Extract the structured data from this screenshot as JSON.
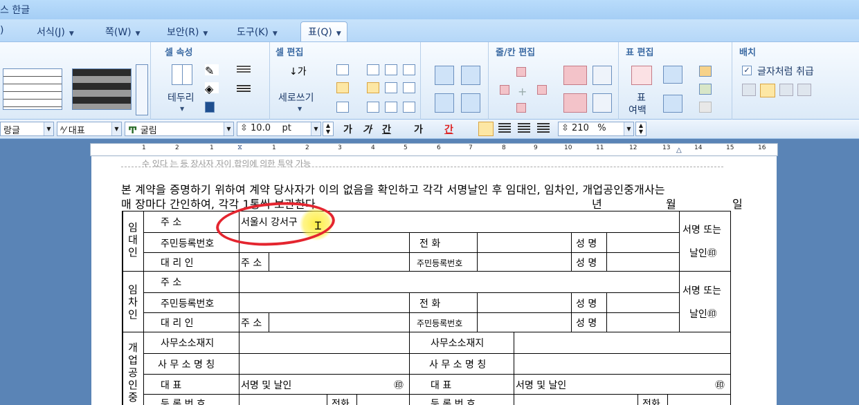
{
  "app": {
    "title_fragment": "스 한글"
  },
  "menu": [
    {
      "label": "서식(J)"
    },
    {
      "label": "쪽(W)"
    },
    {
      "label": "보안(R)"
    },
    {
      "label": "도구(K)"
    },
    {
      "label": "표(Q)"
    }
  ],
  "ribbon": {
    "groups": {
      "cell_attr": "셀 속성",
      "cell_edit": "셀 편집",
      "row_col_edit": "줄/칸 편집",
      "table_edit": "표 편집",
      "arrange": "배치"
    },
    "labels": {
      "border": "테두리",
      "vertical_write": "세로쓰기",
      "table_margin_top": "표",
      "table_margin_bottom": "여백",
      "treat_as_char": "글자처럼 취급"
    },
    "treat_as_char_checked": true
  },
  "format_bar": {
    "style_value": "랑글",
    "font_type": "대표",
    "font_name": "굴림",
    "font_size": "10.0",
    "size_unit": "pt",
    "zoom": "210",
    "zoom_unit": "%",
    "bold_glyph": "가",
    "italic_glyph": "가",
    "underline_glyph": "간",
    "strike_glyph": "가",
    "color_glyph": "간"
  },
  "ruler": {
    "marks": [
      "1",
      "2",
      "1",
      "1",
      "2",
      "3",
      "4",
      "5",
      "6",
      "7",
      "8",
      "9",
      "10",
      "11",
      "12",
      "13",
      "14",
      "15",
      "16"
    ]
  },
  "document": {
    "prev_line": "수 있다 는 등 장사자 자이 합의에 의한 특약 가능",
    "para_line1": "본 계약을 증명하기 위하여 계약 당사자가 이의 없음을 확인하고 각각 서명날인 후 임대인, 임차인, 개업공인중개사는",
    "para_line2": "매 장마다 간인하여, 각각 1통씩 보관한다.",
    "year": "년",
    "month": "월",
    "day": "일",
    "lessor": {
      "side_label": "임대인",
      "address_label": "주        소",
      "address_value": "서울시 강서구",
      "rrn_label": "주민등록번호",
      "phone_label": "전        화",
      "name_label": "성  명",
      "agent_label": "대  리  인",
      "agent_addr": "주 소",
      "agent_rrn": "주민등록번호",
      "agent_name": "성  명",
      "sign1": "서명 또는",
      "sign2": "날인㊞"
    },
    "lessee": {
      "side_label": "임차인",
      "address_label": "주        소",
      "rrn_label": "주민등록번호",
      "phone_label": "전        화",
      "name_label": "성  명",
      "agent_label": "대  리  인",
      "agent_addr": "주 소",
      "agent_rrn": "주민등록번호",
      "agent_name": "성  명",
      "sign1": "서명 또는",
      "sign2": "날인㊞"
    },
    "broker": {
      "side_label": "개업공인중",
      "office_addr": "사무소소재지",
      "office_name": "사 무 소 명 칭",
      "rep": "대        표",
      "sign_seal": "서명 및 날인",
      "seal": "㊞",
      "reg_no": "등  록  번  호",
      "phone": "전화"
    }
  }
}
